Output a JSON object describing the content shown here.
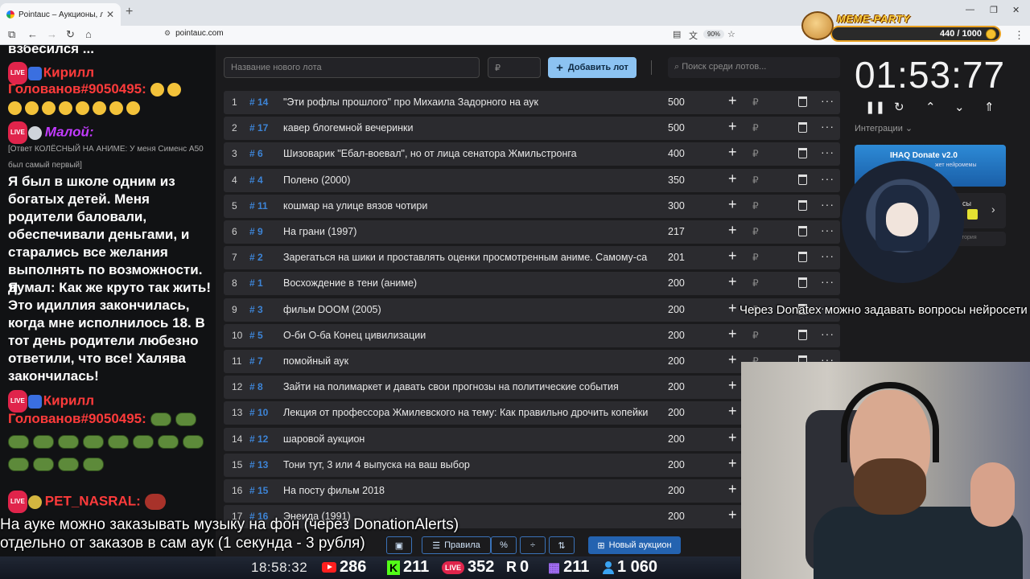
{
  "browser": {
    "tab_title": "Pointauc – Аукционы, лотереи",
    "tab_close": "✕",
    "new_tab": "+",
    "url": "pointauc.com",
    "zoom": "90%"
  },
  "meme_party": {
    "title": "MEME-PARTY",
    "count": "440 / 1000",
    "progress": 0.44
  },
  "chat": {
    "top_fragment": "взбесился ...",
    "msg1_name_line1": "Кирилл",
    "msg1_name_line2": "Голованов#9050495:",
    "msg2_name": "Малой:",
    "msg2_reply": "[Ответ КОЛЁСНЫЙ НА АНИМЕ: У меня Сименс А50 был самый первый]",
    "msg2_lines": [
      "Я был в школе одним из",
      "богатых детей. Меня",
      "родители баловали,",
      "обеспечивали деньгами, и",
      "старались все желания",
      "выполнять по возможности. Я",
      "думал: Как же круто так жить!",
      "Это идиллия закончилась,",
      "когда мне исполнилось 18. В",
      "тот день родители любезно",
      "ответили, что все! Халява",
      "закончилась!"
    ],
    "msg3_name_line1": "Кирилл",
    "msg3_name_line2": "Голованов#9050495:",
    "msg4_name": "PET_NASRAL:",
    "live_badge": "LIVE"
  },
  "controls": {
    "new_lot_placeholder": "Название нового лота",
    "amount_placeholder": "₽",
    "add_lot_label": "Добавить лот",
    "search_placeholder": "Поиск среди лотов..."
  },
  "lots": [
    {
      "n": "1",
      "id": "# 14",
      "name": "\"Эти рофлы прошлого\" про Михаила Задорного на аук",
      "amount": "500"
    },
    {
      "n": "2",
      "id": "# 17",
      "name": "кавер блогемной вечеринки",
      "amount": "500"
    },
    {
      "n": "3",
      "id": "# 6",
      "name": "Шизоварик \"Ебал-воевал\", но от лица сенатора Жмильстронга",
      "amount": "400"
    },
    {
      "n": "4",
      "id": "# 4",
      "name": "Полено (2000)",
      "amount": "350"
    },
    {
      "n": "5",
      "id": "# 11",
      "name": "кошмар на улице вязов чотири",
      "amount": "300"
    },
    {
      "n": "6",
      "id": "# 9",
      "name": "На грани (1997)",
      "amount": "217"
    },
    {
      "n": "7",
      "id": "# 2",
      "name": "Зарегаться на шики и проставлять оценки просмотренным аниме. Самому-са",
      "amount": "201"
    },
    {
      "n": "8",
      "id": "# 1",
      "name": "Восхождение в тени (аниме)",
      "amount": "200"
    },
    {
      "n": "9",
      "id": "# 3",
      "name": "фильм DOOM (2005)",
      "amount": "200"
    },
    {
      "n": "10",
      "id": "# 5",
      "name": "О-би О-ба Конец цивилизации",
      "amount": "200"
    },
    {
      "n": "11",
      "id": "# 7",
      "name": "помойный аук",
      "amount": "200"
    },
    {
      "n": "12",
      "id": "# 8",
      "name": "Зайти на полимаркет и давать свои прогнозы на политические события",
      "amount": "200"
    },
    {
      "n": "13",
      "id": "# 10",
      "name": "Лекция от профессора Жмилевского на тему: Как правильно дрочить копейки",
      "amount": "200"
    },
    {
      "n": "14",
      "id": "# 12",
      "name": "шаровой аукцион",
      "amount": "200"
    },
    {
      "n": "15",
      "id": "# 13",
      "name": "Тони тут, 3 или 4 выпуска на ваш выбор",
      "amount": "200"
    },
    {
      "n": "16",
      "id": "# 15",
      "name": "На посту фильм 2018",
      "amount": "200"
    },
    {
      "n": "17",
      "id": "# 16",
      "name": "Энеида (1991)",
      "amount": "200"
    }
  ],
  "row_icons": {
    "plus": "+",
    "rub": "₽",
    "more": "···"
  },
  "timer": {
    "value": "01:53:77",
    "integrations_label": "Интеграции",
    "donate_title": "IHAQ Donate v2.0",
    "donate_sub": "жет нейромемы",
    "panel_text": "сы",
    "panel2_text": "тория"
  },
  "overlays": {
    "tip": "Через Donatex можно задавать вопросы нейросети",
    "subtitle_line1": "На ауке можно заказывать музыку на фон (через DonationAlerts)",
    "subtitle_line2": "отдельно от заказов в сам аук (1 секунда - 3 рубля)"
  },
  "toolbar": {
    "rules_label": "Правила",
    "new_auction_label": "Новый аукцион"
  },
  "stats": {
    "time": "18:58:32",
    "youtube": "286",
    "kick": "211",
    "live": "352",
    "rumble": "0",
    "twitch": "211",
    "total": "1 060"
  },
  "colors": {
    "accent": "#8cc3f2",
    "id_blue": "#3d84d6",
    "nickname_red": "#ff3b3b",
    "nickname_purple": "#c23bff"
  }
}
